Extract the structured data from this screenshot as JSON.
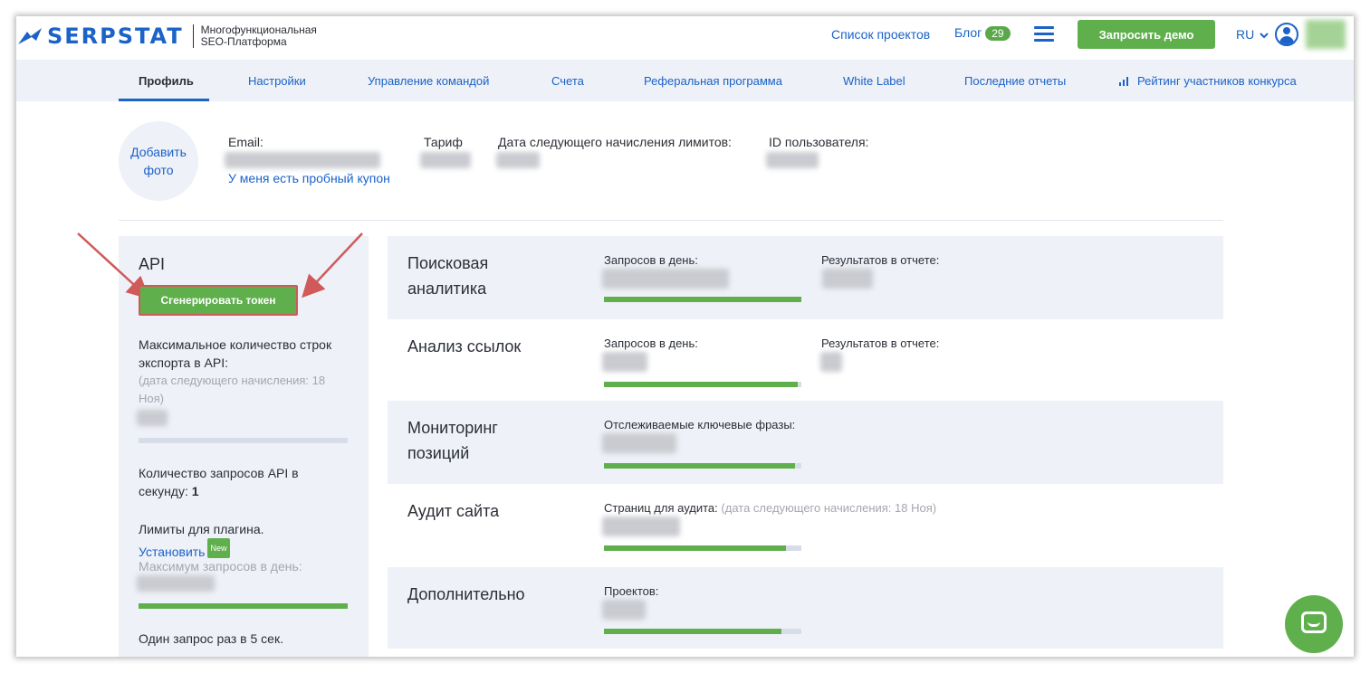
{
  "header": {
    "brand": "SERPSTAT",
    "subtitle_line1": "Многофункциональная",
    "subtitle_line2": "SEO-Платформа",
    "projects_link": "Список проектов",
    "blog_link": "Блог",
    "blog_count": "29",
    "demo_button": "Запросить демо",
    "language": "RU"
  },
  "tabs": [
    {
      "label": "Профиль",
      "active": true
    },
    {
      "label": "Настройки"
    },
    {
      "label": "Управление командой"
    },
    {
      "label": "Счета"
    },
    {
      "label": "Реферальная программа"
    },
    {
      "label": "White Label"
    },
    {
      "label": "Последние отчеты"
    },
    {
      "label": "Рейтинг участников конкурса"
    }
  ],
  "profile": {
    "add_photo_line1": "Добавить",
    "add_photo_line2": "фото",
    "email_label": "Email:",
    "tariff_label": "Тариф",
    "next_limits_label": "Дата следующего начисления лимитов:",
    "user_id_label": "ID пользователя:",
    "coupon_link": "У меня есть пробный купон"
  },
  "api": {
    "title": "API",
    "generate_button": "Сгенерировать токен",
    "max_rows_line1": "Максимальное количество строк",
    "max_rows_line2": "экспорта в API:",
    "next_date_line1": "(дата следующего начисления: 18",
    "next_date_line2": "Ноя)",
    "rows_fill": 0.0,
    "rps_line1": "Количество запросов API в",
    "rps_line2_prefix": "секунду: ",
    "rps_value": "1",
    "plugin_limits": "Лимиты для плагина.",
    "install_link": "Установить",
    "new_badge": "New",
    "max_requests_day": "Максимум запросов в день:",
    "plugin_fill": 1.0,
    "one_request": "Один запрос раз в 5 сек."
  },
  "cards": [
    {
      "title_line1": "Поисковая",
      "title_line2": "аналитика",
      "col1": "Запросов в день:",
      "col2": "Результатов в отчете:",
      "fill": 1.0
    },
    {
      "title_line1": "Анализ ссылок",
      "title_line2": "",
      "col1": "Запросов в день:",
      "col2": "Результатов в отчете:",
      "fill": 0.98
    },
    {
      "title_line1": "Мониторинг",
      "title_line2": "позиций",
      "col1": "Отслеживаемые ключевые фразы:",
      "col2": "",
      "fill": 0.97
    },
    {
      "title_line1": "Аудит сайта",
      "title_line2": "",
      "col1": "Страниц для аудита:",
      "col1_note": "(дата следующего начисления: 18 Ноя)",
      "col2": "",
      "fill": 0.92
    },
    {
      "title_line1": "Дополнительно",
      "title_line2": "",
      "col1": "Проектов:",
      "col2": "",
      "fill": 0.9
    }
  ],
  "colors": {
    "brand_blue": "#1b62c9",
    "accent_green": "#5fb04d",
    "panel_bg": "#eef1f7",
    "highlight_red": "#d0595a"
  }
}
